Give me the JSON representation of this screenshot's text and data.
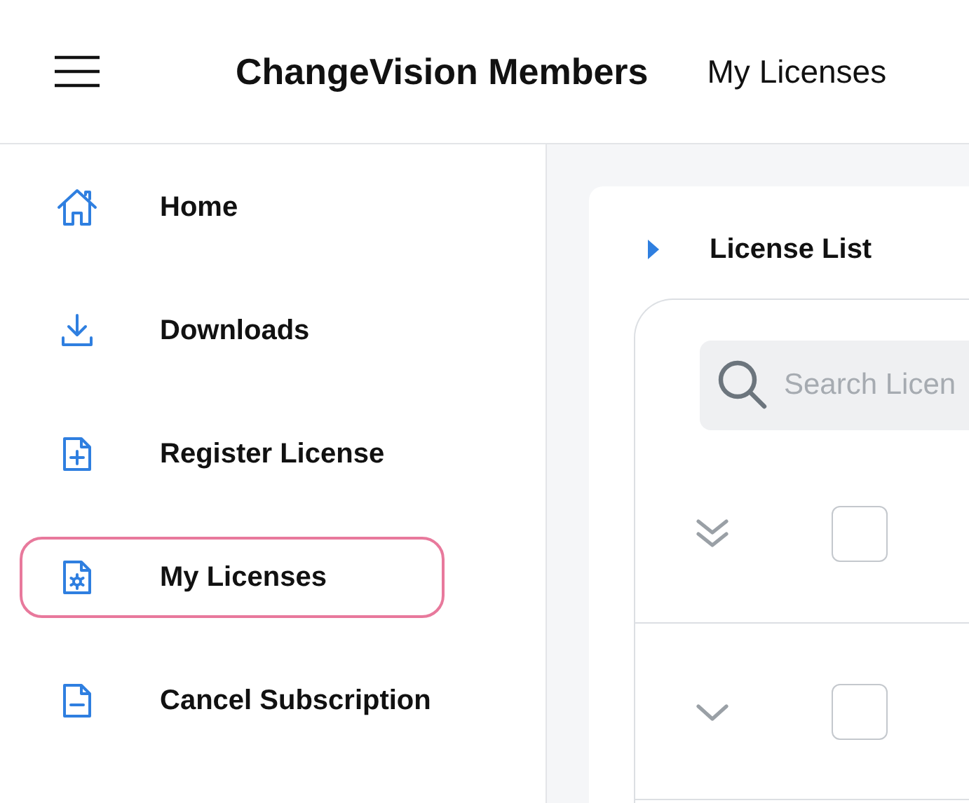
{
  "header": {
    "title": "ChangeVision Members",
    "page": "My Licenses"
  },
  "sidebar": {
    "items": [
      {
        "label": "Home",
        "kind": "home",
        "selected": false
      },
      {
        "label": "Downloads",
        "kind": "download",
        "selected": false
      },
      {
        "label": "Register License",
        "kind": "register",
        "selected": false
      },
      {
        "label": "My Licenses",
        "kind": "licenses",
        "selected": true
      },
      {
        "label": "Cancel Subscription",
        "kind": "cancel",
        "selected": false
      }
    ]
  },
  "panel": {
    "title": "License List",
    "expanded": false,
    "search": {
      "placeholder": "Search Licen"
    },
    "rows": [
      {
        "kind": "expand-all",
        "checked": false
      },
      {
        "kind": "expand",
        "checked": false
      }
    ]
  }
}
